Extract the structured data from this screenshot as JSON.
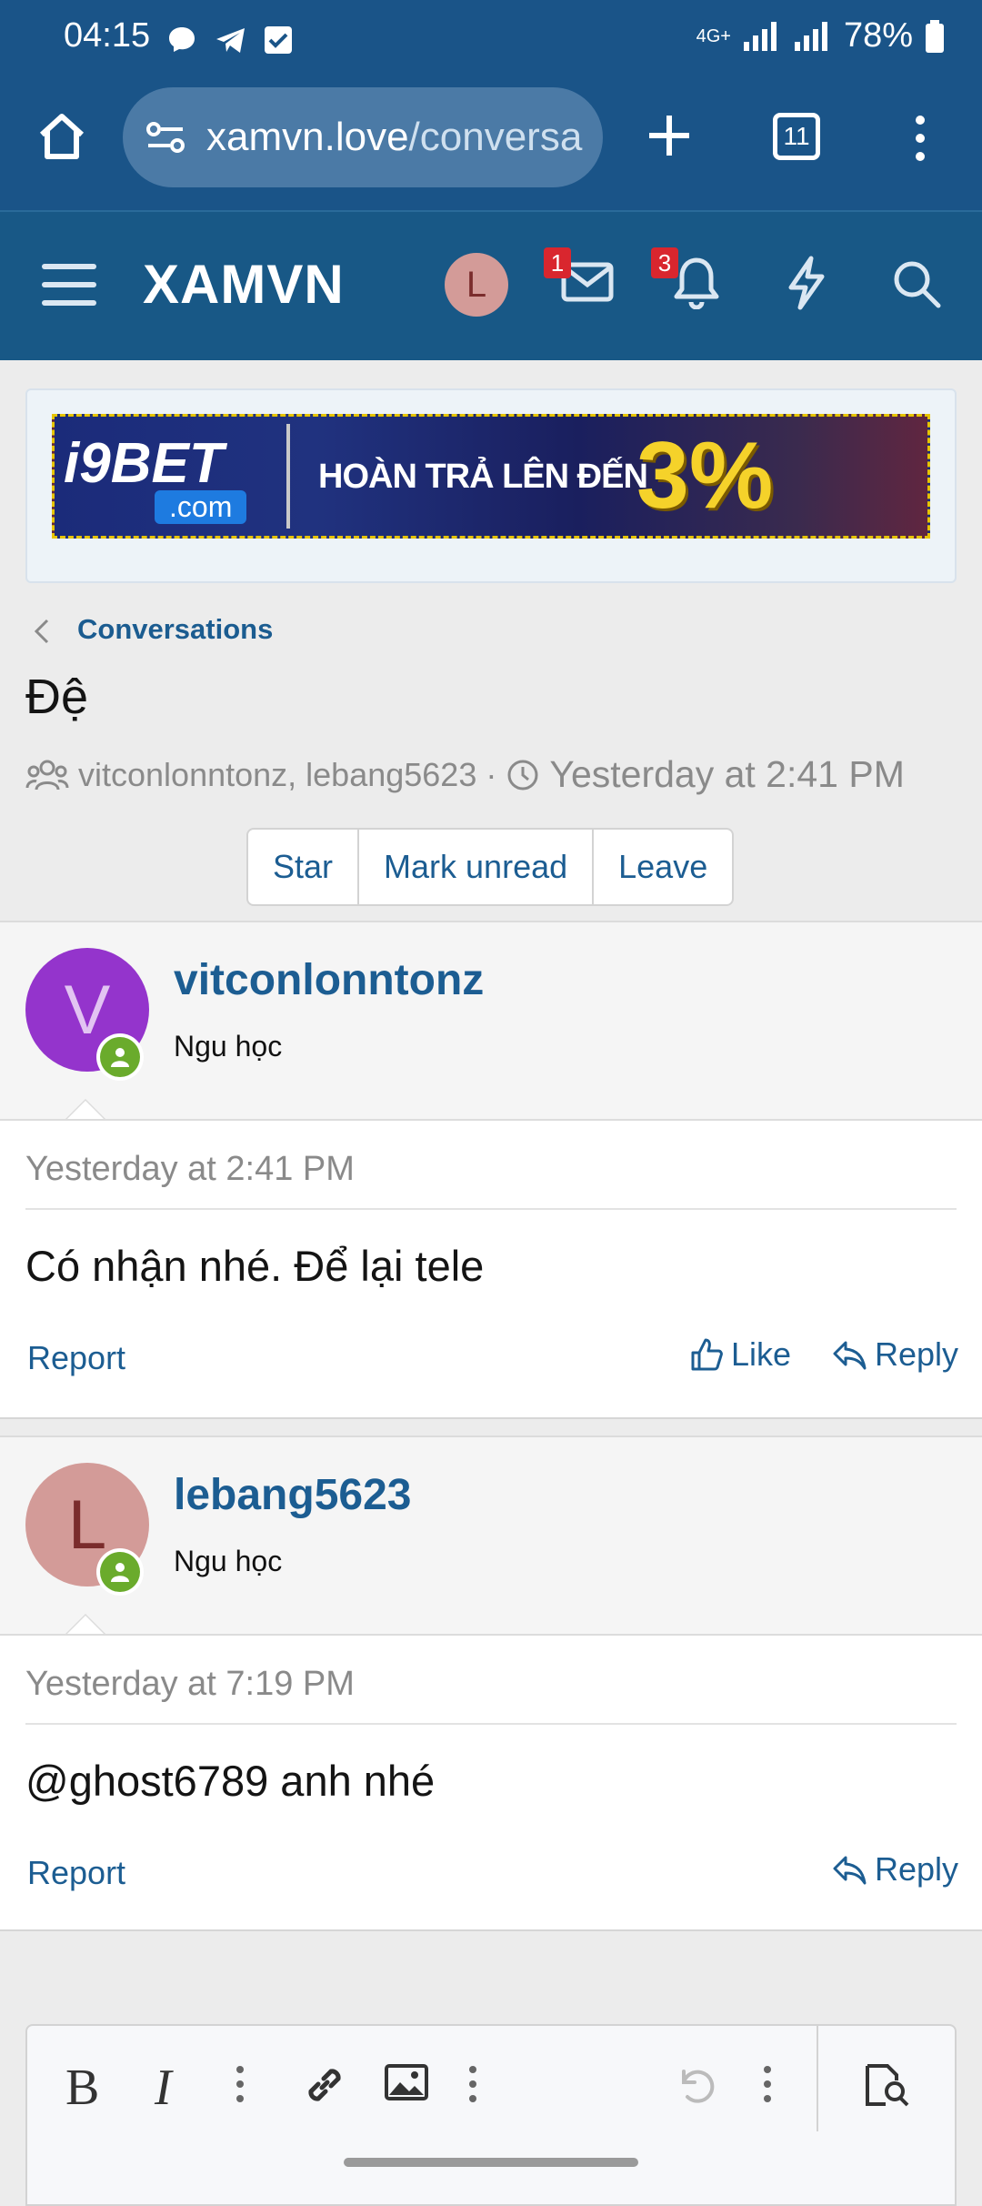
{
  "status_bar": {
    "time": "04:15",
    "network": "4G+",
    "battery": "78%"
  },
  "browser": {
    "url_host": "xamvn.love",
    "url_path": "/conversa",
    "tab_count": "11"
  },
  "site": {
    "logo": "XAMVN",
    "avatar_letter": "L",
    "inbox_badge": "1",
    "alerts_badge": "3"
  },
  "ad": {
    "brand": "i9BET",
    "brand_suffix": ".com",
    "message": "HOÀN TRẢ LÊN ĐẾN",
    "percent": "3%"
  },
  "conversation": {
    "breadcrumb": "Conversations",
    "title": "Đệ",
    "participants": "vitconlonntonz, lebang5623",
    "separator": "·",
    "time": "Yesterday at 2:41 PM",
    "buttons": {
      "star": "Star",
      "mark_unread": "Mark unread",
      "leave": "Leave"
    }
  },
  "messages": [
    {
      "avatar_letter": "V",
      "avatar_color": "#9434cc",
      "username": "vitconlonntonz",
      "user_title": "Ngu học",
      "timestamp": "Yesterday at 2:41 PM",
      "text": "Có nhận nhé. Để lại tele",
      "report": "Report",
      "like": "Like",
      "reply": "Reply"
    },
    {
      "avatar_letter": "L",
      "avatar_color": "#d39b98",
      "username": "lebang5623",
      "user_title": "Ngu học",
      "timestamp": "Yesterday at 7:19 PM",
      "text": "@ghost6789 anh nhé",
      "report": "Report",
      "reply": "Reply"
    }
  ],
  "editor": {
    "tools": [
      "bold",
      "italic",
      "more",
      "link",
      "image",
      "more",
      "undo",
      "more",
      "preview"
    ]
  },
  "colors": {
    "header": "#185886",
    "link": "#1c5d92",
    "online": "#6aab2c"
  }
}
